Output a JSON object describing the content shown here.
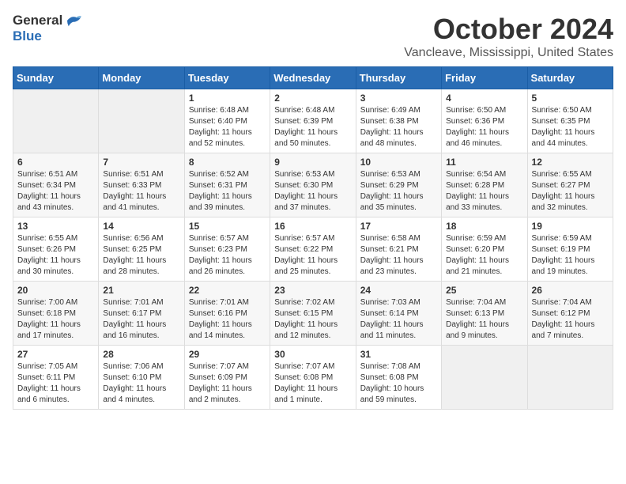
{
  "header": {
    "logo_general": "General",
    "logo_blue": "Blue",
    "title": "October 2024",
    "location": "Vancleave, Mississippi, United States"
  },
  "weekdays": [
    "Sunday",
    "Monday",
    "Tuesday",
    "Wednesday",
    "Thursday",
    "Friday",
    "Saturday"
  ],
  "weeks": [
    {
      "days": [
        {
          "number": "",
          "detail": "",
          "empty": true
        },
        {
          "number": "",
          "detail": "",
          "empty": true
        },
        {
          "number": "1",
          "detail": "Sunrise: 6:48 AM\nSunset: 6:40 PM\nDaylight: 11 hours and 52 minutes."
        },
        {
          "number": "2",
          "detail": "Sunrise: 6:48 AM\nSunset: 6:39 PM\nDaylight: 11 hours and 50 minutes."
        },
        {
          "number": "3",
          "detail": "Sunrise: 6:49 AM\nSunset: 6:38 PM\nDaylight: 11 hours and 48 minutes."
        },
        {
          "number": "4",
          "detail": "Sunrise: 6:50 AM\nSunset: 6:36 PM\nDaylight: 11 hours and 46 minutes."
        },
        {
          "number": "5",
          "detail": "Sunrise: 6:50 AM\nSunset: 6:35 PM\nDaylight: 11 hours and 44 minutes."
        }
      ]
    },
    {
      "days": [
        {
          "number": "6",
          "detail": "Sunrise: 6:51 AM\nSunset: 6:34 PM\nDaylight: 11 hours and 43 minutes."
        },
        {
          "number": "7",
          "detail": "Sunrise: 6:51 AM\nSunset: 6:33 PM\nDaylight: 11 hours and 41 minutes."
        },
        {
          "number": "8",
          "detail": "Sunrise: 6:52 AM\nSunset: 6:31 PM\nDaylight: 11 hours and 39 minutes."
        },
        {
          "number": "9",
          "detail": "Sunrise: 6:53 AM\nSunset: 6:30 PM\nDaylight: 11 hours and 37 minutes."
        },
        {
          "number": "10",
          "detail": "Sunrise: 6:53 AM\nSunset: 6:29 PM\nDaylight: 11 hours and 35 minutes."
        },
        {
          "number": "11",
          "detail": "Sunrise: 6:54 AM\nSunset: 6:28 PM\nDaylight: 11 hours and 33 minutes."
        },
        {
          "number": "12",
          "detail": "Sunrise: 6:55 AM\nSunset: 6:27 PM\nDaylight: 11 hours and 32 minutes."
        }
      ]
    },
    {
      "days": [
        {
          "number": "13",
          "detail": "Sunrise: 6:55 AM\nSunset: 6:26 PM\nDaylight: 11 hours and 30 minutes."
        },
        {
          "number": "14",
          "detail": "Sunrise: 6:56 AM\nSunset: 6:25 PM\nDaylight: 11 hours and 28 minutes."
        },
        {
          "number": "15",
          "detail": "Sunrise: 6:57 AM\nSunset: 6:23 PM\nDaylight: 11 hours and 26 minutes."
        },
        {
          "number": "16",
          "detail": "Sunrise: 6:57 AM\nSunset: 6:22 PM\nDaylight: 11 hours and 25 minutes."
        },
        {
          "number": "17",
          "detail": "Sunrise: 6:58 AM\nSunset: 6:21 PM\nDaylight: 11 hours and 23 minutes."
        },
        {
          "number": "18",
          "detail": "Sunrise: 6:59 AM\nSunset: 6:20 PM\nDaylight: 11 hours and 21 minutes."
        },
        {
          "number": "19",
          "detail": "Sunrise: 6:59 AM\nSunset: 6:19 PM\nDaylight: 11 hours and 19 minutes."
        }
      ]
    },
    {
      "days": [
        {
          "number": "20",
          "detail": "Sunrise: 7:00 AM\nSunset: 6:18 PM\nDaylight: 11 hours and 17 minutes."
        },
        {
          "number": "21",
          "detail": "Sunrise: 7:01 AM\nSunset: 6:17 PM\nDaylight: 11 hours and 16 minutes."
        },
        {
          "number": "22",
          "detail": "Sunrise: 7:01 AM\nSunset: 6:16 PM\nDaylight: 11 hours and 14 minutes."
        },
        {
          "number": "23",
          "detail": "Sunrise: 7:02 AM\nSunset: 6:15 PM\nDaylight: 11 hours and 12 minutes."
        },
        {
          "number": "24",
          "detail": "Sunrise: 7:03 AM\nSunset: 6:14 PM\nDaylight: 11 hours and 11 minutes."
        },
        {
          "number": "25",
          "detail": "Sunrise: 7:04 AM\nSunset: 6:13 PM\nDaylight: 11 hours and 9 minutes."
        },
        {
          "number": "26",
          "detail": "Sunrise: 7:04 AM\nSunset: 6:12 PM\nDaylight: 11 hours and 7 minutes."
        }
      ]
    },
    {
      "days": [
        {
          "number": "27",
          "detail": "Sunrise: 7:05 AM\nSunset: 6:11 PM\nDaylight: 11 hours and 6 minutes."
        },
        {
          "number": "28",
          "detail": "Sunrise: 7:06 AM\nSunset: 6:10 PM\nDaylight: 11 hours and 4 minutes."
        },
        {
          "number": "29",
          "detail": "Sunrise: 7:07 AM\nSunset: 6:09 PM\nDaylight: 11 hours and 2 minutes."
        },
        {
          "number": "30",
          "detail": "Sunrise: 7:07 AM\nSunset: 6:08 PM\nDaylight: 11 hours and 1 minute."
        },
        {
          "number": "31",
          "detail": "Sunrise: 7:08 AM\nSunset: 6:08 PM\nDaylight: 10 hours and 59 minutes."
        },
        {
          "number": "",
          "detail": "",
          "empty": true
        },
        {
          "number": "",
          "detail": "",
          "empty": true
        }
      ]
    }
  ]
}
